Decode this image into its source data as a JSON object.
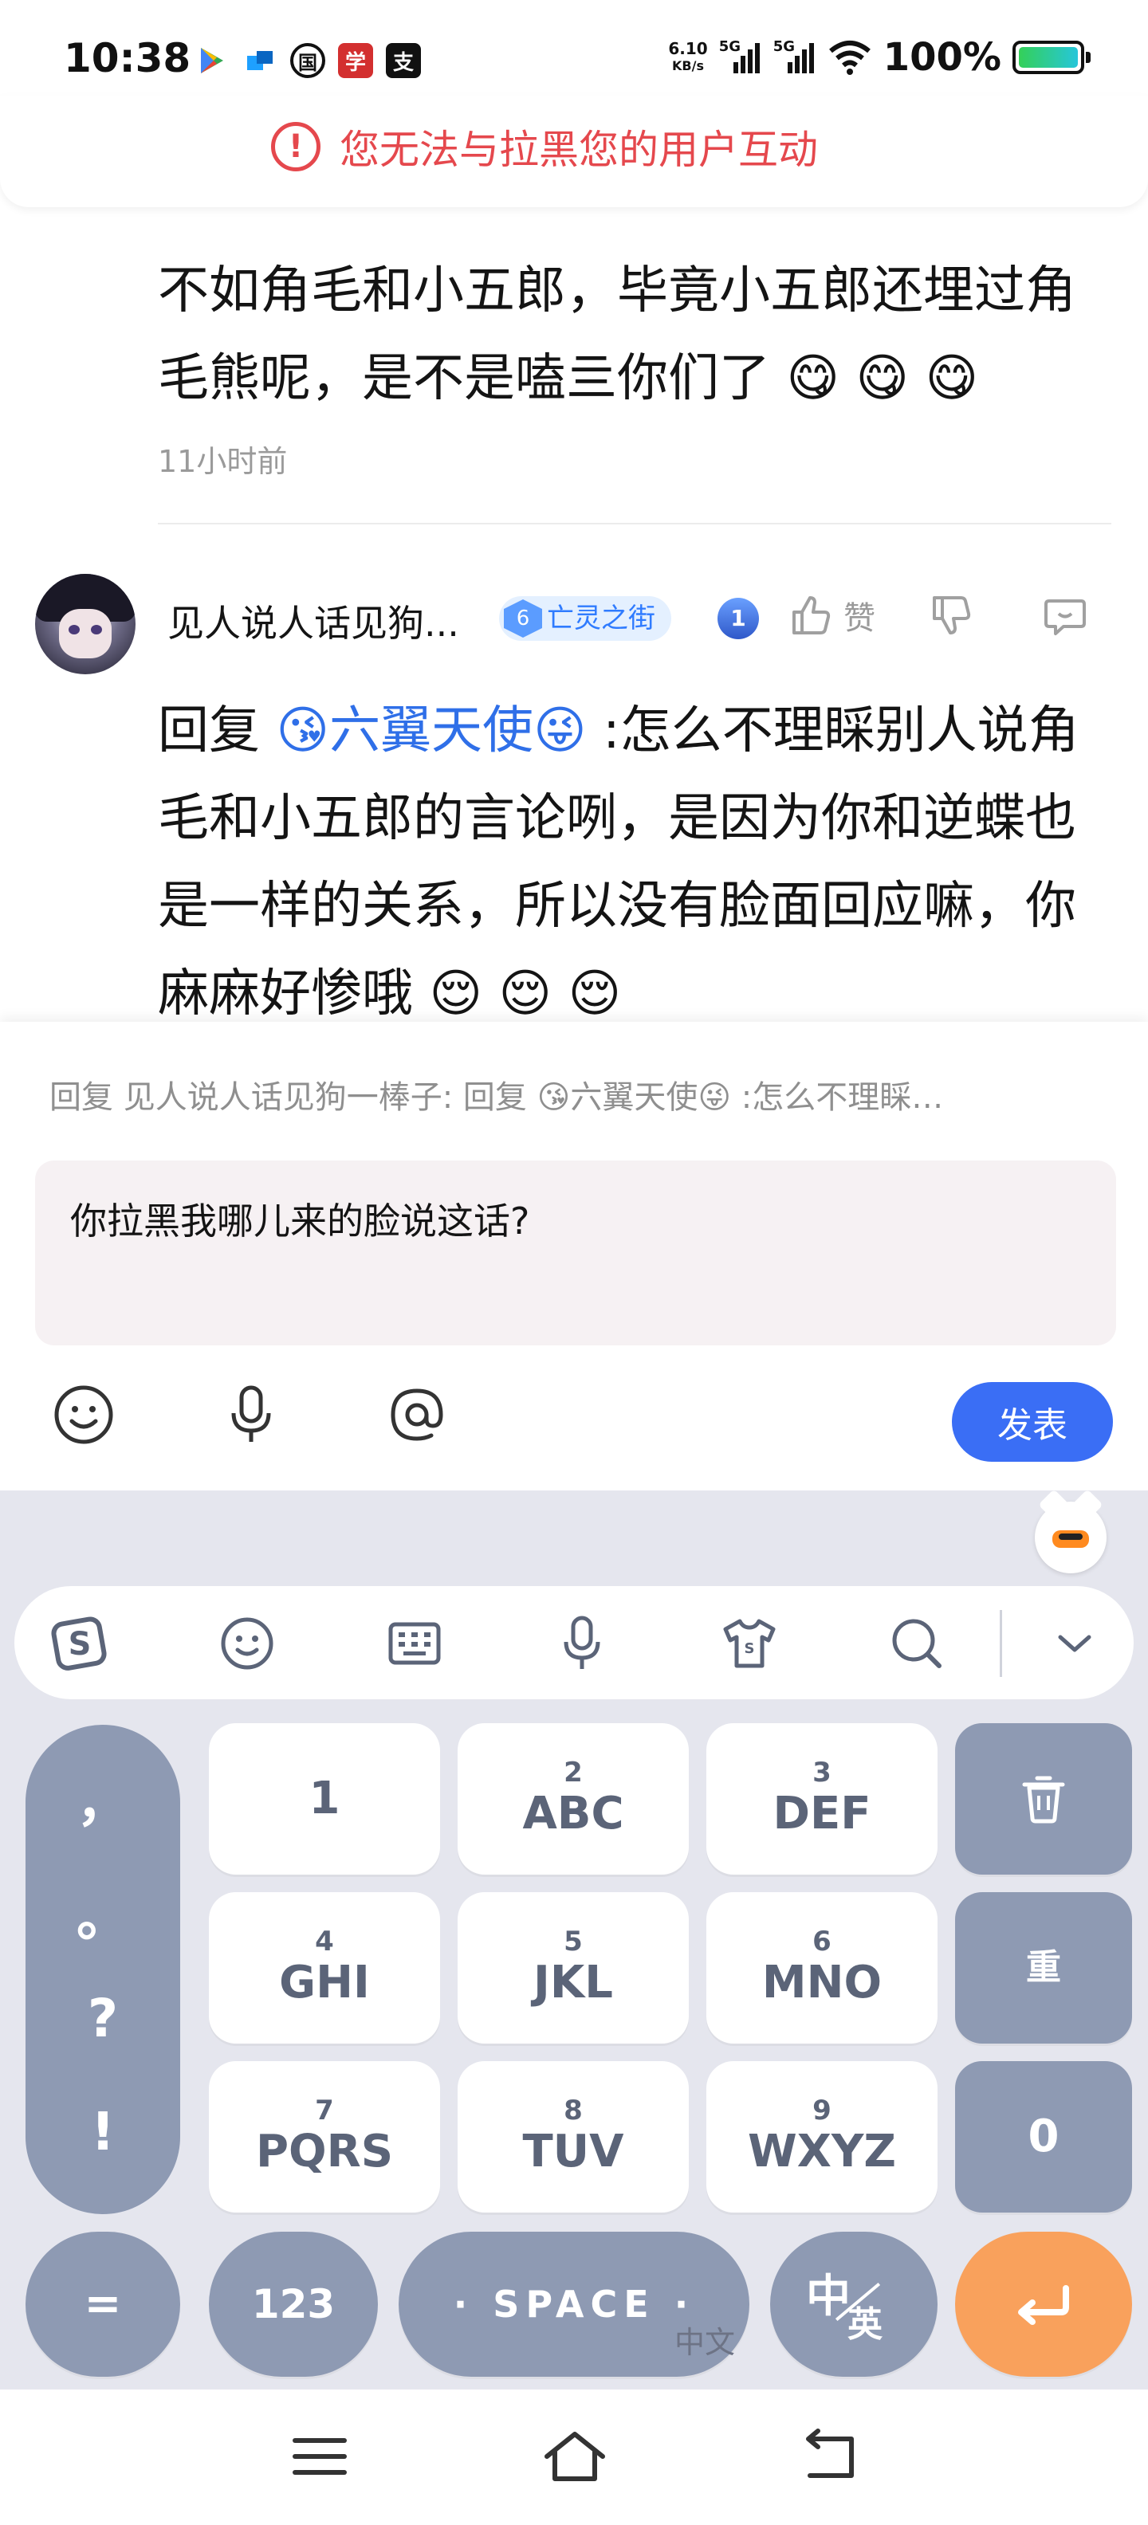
{
  "status_bar": {
    "time": "10:38",
    "net_speed_value": "6.10",
    "net_speed_unit": "KB/s",
    "sim1": "5G",
    "sim2": "5G",
    "battery": "100%",
    "app_icons": [
      "play-store-icon",
      "blue-app-icon",
      "guo-app-icon",
      "red-app-icon",
      "alipay-icon"
    ]
  },
  "banner": {
    "warning_text": "您无法与拉黑您的用户互动",
    "color": "#e5484d"
  },
  "post": {
    "text": "不如角毛和小五郎，毕竟小五郎还埋过角毛熊呢，是不是嗑亖你们了 😋 😋 😋",
    "time": "11小时前"
  },
  "comment": {
    "username": "见人说人话见狗...",
    "level": "6",
    "level_title": "亡灵之街",
    "rank": "1",
    "like_label": "赞",
    "reply_prefix": "回复 ",
    "reply_mention": "😘六翼天使😜",
    "reply_body": " :怎么不理睬别人说角毛和小五郎的言论咧，是因为你和逆蝶也是一样的关系，所以没有脸面回应嘛，你麻麻好惨哦 😌 😌 😌"
  },
  "compose": {
    "quote": "回复 见人说人话见狗一棒子: 回复 😘六翼天使😜  :怎么不理睬…",
    "input_value": "你拉黑我哪儿来的脸说这话?",
    "send_label": "发表",
    "accent_color": "#3a6ef5"
  },
  "keyboard": {
    "keys": [
      {
        "num": "",
        "letters": "1"
      },
      {
        "num": "2",
        "letters": "ABC"
      },
      {
        "num": "3",
        "letters": "DEF"
      },
      {
        "num": "4",
        "letters": "GHI"
      },
      {
        "num": "5",
        "letters": "JKL"
      },
      {
        "num": "6",
        "letters": "MNO"
      },
      {
        "num": "7",
        "letters": "PQRS"
      },
      {
        "num": "8",
        "letters": "TUV"
      },
      {
        "num": "9",
        "letters": "WXYZ"
      }
    ],
    "punct": [
      "，",
      "。",
      "?",
      "!"
    ],
    "reset_label": "重",
    "zero_label": "0",
    "equals_label": "=",
    "num_label": "123",
    "space_label": "· SPACE ·",
    "lang_main": "中",
    "lang_sub": "英",
    "mode_caption": "中文"
  }
}
